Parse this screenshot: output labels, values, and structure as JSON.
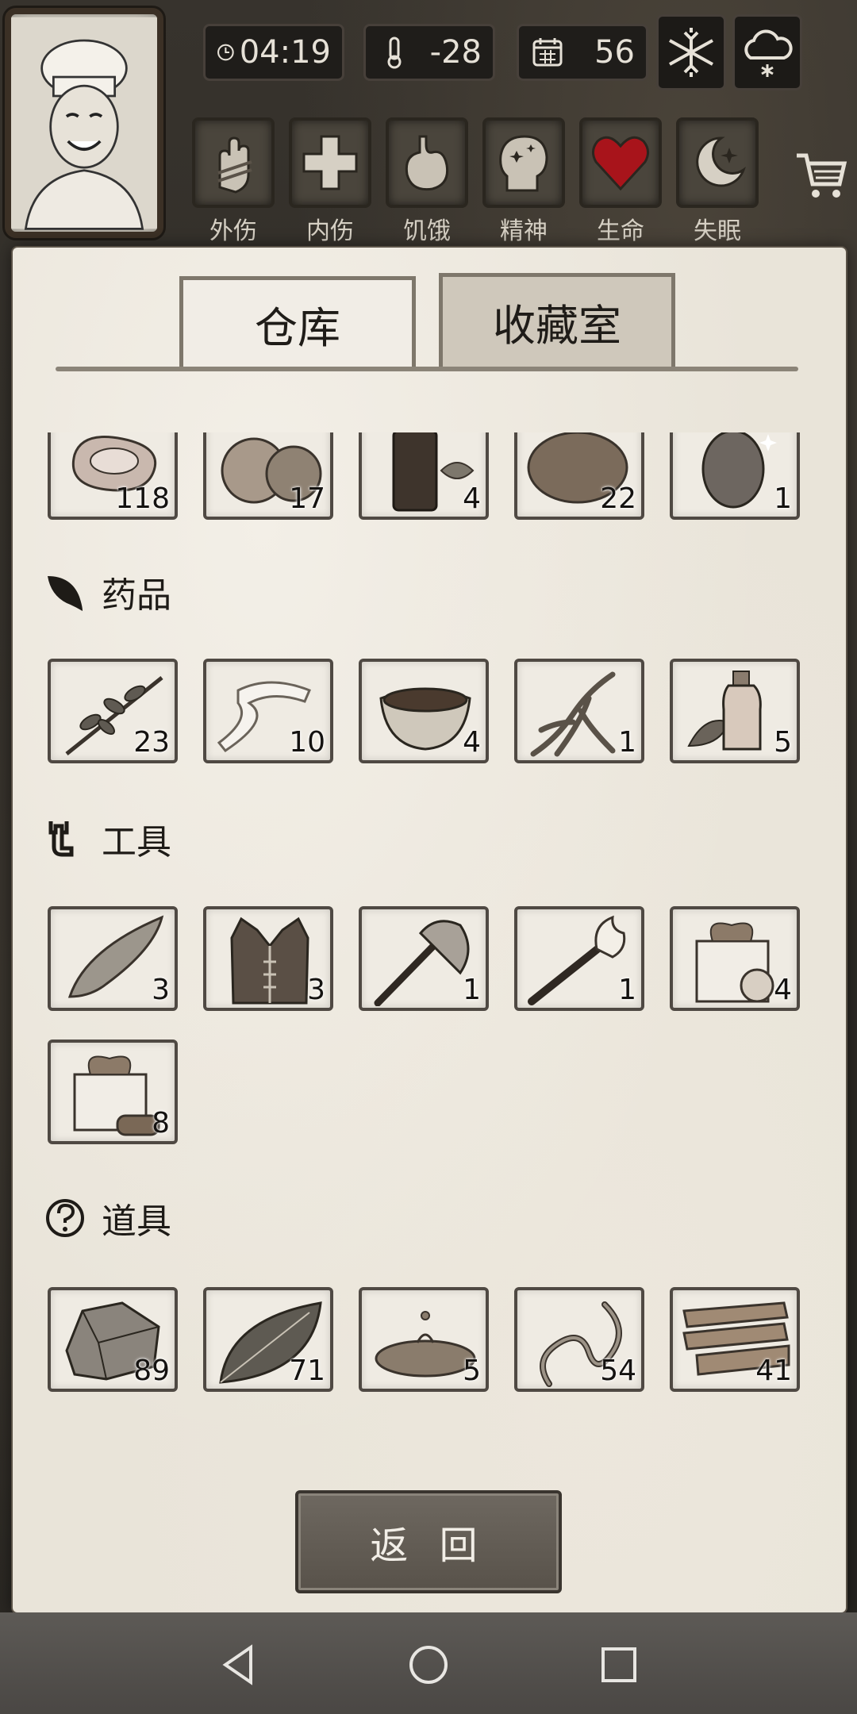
{
  "hud": {
    "time": "04:19",
    "temperature": "-28",
    "day": "56",
    "weather": [
      "snowflake-icon",
      "snow-cloud-icon"
    ],
    "status": [
      {
        "label": "外伤",
        "icon": "hand-icon"
      },
      {
        "label": "内伤",
        "icon": "cross-icon"
      },
      {
        "label": "饥饿",
        "icon": "stomach-icon"
      },
      {
        "label": "精神",
        "icon": "head-icon"
      },
      {
        "label": "生命",
        "icon": "heart-icon"
      },
      {
        "label": "失眠",
        "icon": "moon-icon"
      }
    ]
  },
  "tabs": {
    "storage": "仓库",
    "collection": "收藏室"
  },
  "categories": {
    "food": {
      "items": [
        {
          "icon": "meat-icon",
          "qty": "118"
        },
        {
          "icon": "coconut-icon",
          "qty": "17"
        },
        {
          "icon": "log-herb-icon",
          "qty": "4"
        },
        {
          "icon": "potato-icon",
          "qty": "22"
        },
        {
          "icon": "egg-icon",
          "qty": "1"
        }
      ]
    },
    "medicine": {
      "title": "药品",
      "items": [
        {
          "icon": "herb-branch-icon",
          "qty": "23"
        },
        {
          "icon": "bandage-icon",
          "qty": "10"
        },
        {
          "icon": "bowl-icon",
          "qty": "4"
        },
        {
          "icon": "ginseng-icon",
          "qty": "1"
        },
        {
          "icon": "bottle-icon",
          "qty": "5"
        }
      ]
    },
    "tools": {
      "title": "工具",
      "items": [
        {
          "icon": "stone-blade-icon",
          "qty": "3"
        },
        {
          "icon": "vest-icon",
          "qty": "3"
        },
        {
          "icon": "axe-icon",
          "qty": "1"
        },
        {
          "icon": "torch-icon",
          "qty": "1"
        },
        {
          "icon": "gift-box-icon",
          "qty": "4"
        },
        {
          "icon": "gift-box-wood-icon",
          "qty": "8"
        }
      ]
    },
    "props": {
      "title": "道具",
      "items": [
        {
          "icon": "rock-icon",
          "qty": "89"
        },
        {
          "icon": "leaf-icon",
          "qty": "71"
        },
        {
          "icon": "mud-icon",
          "qty": "5"
        },
        {
          "icon": "vine-icon",
          "qty": "54"
        },
        {
          "icon": "planks-icon",
          "qty": "41"
        }
      ]
    }
  },
  "return_button": "返 回",
  "colors": {
    "paper": "#e9e4d9",
    "heart": "#a8141b",
    "frame": "#4f4943"
  }
}
